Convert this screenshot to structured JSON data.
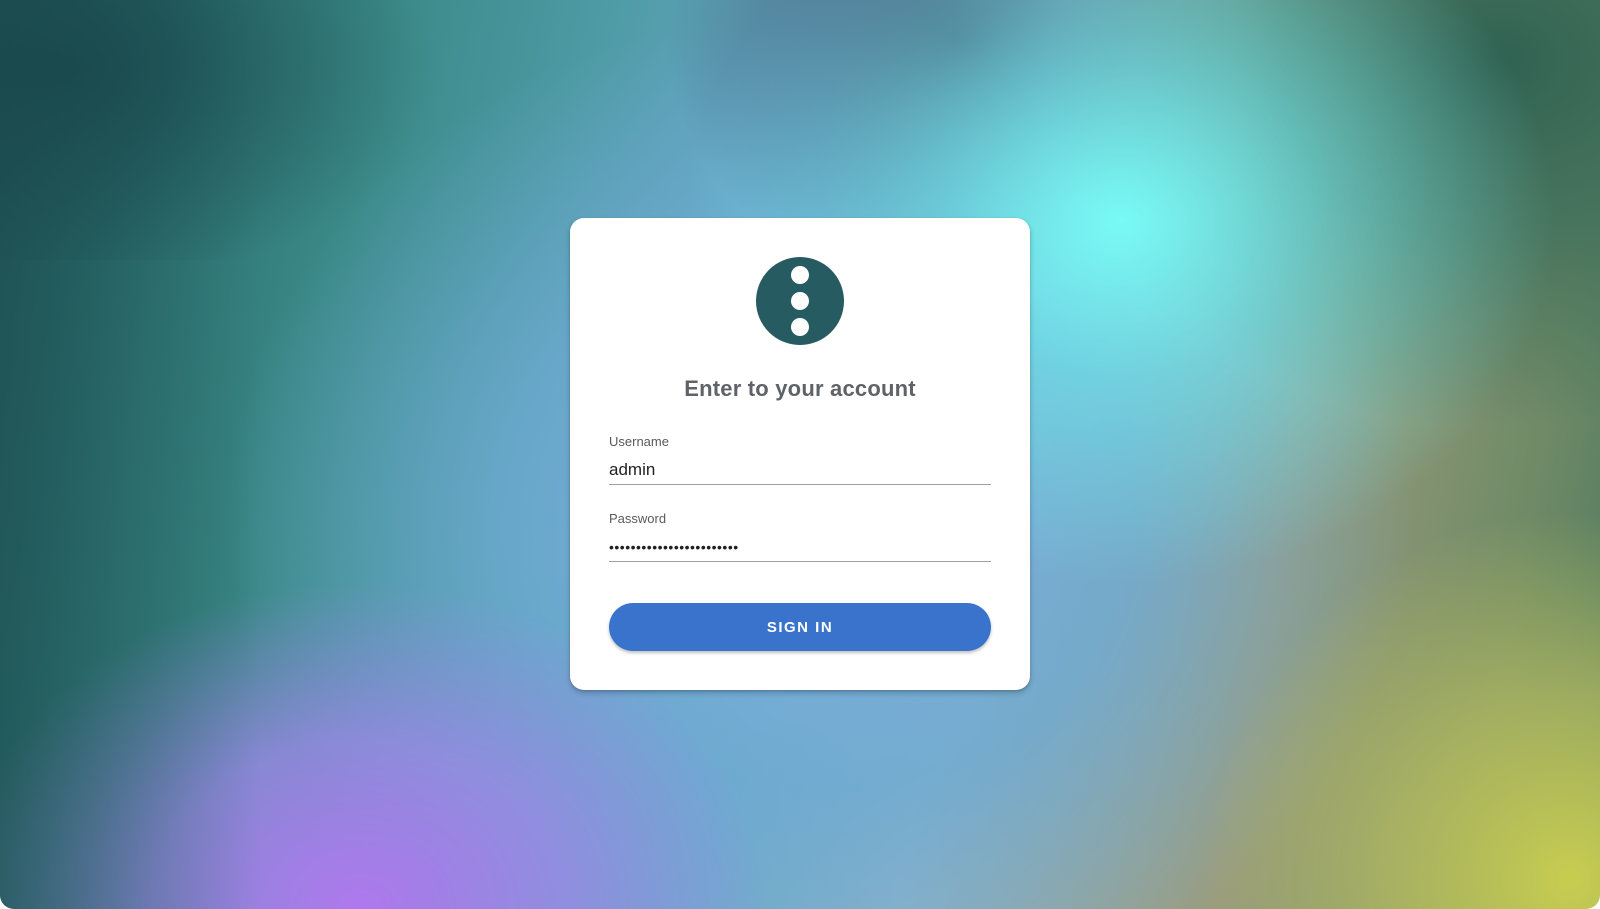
{
  "login": {
    "title": "Enter to your account",
    "username_label": "Username",
    "username_value": "admin",
    "password_label": "Password",
    "password_value": "••••••••••••••••••••••••",
    "sign_in_label": "SIGN IN"
  },
  "logo": {
    "icon": "vertical-dots-icon",
    "color": "#255b61"
  },
  "theme": {
    "button_color": "#3a73cc"
  }
}
